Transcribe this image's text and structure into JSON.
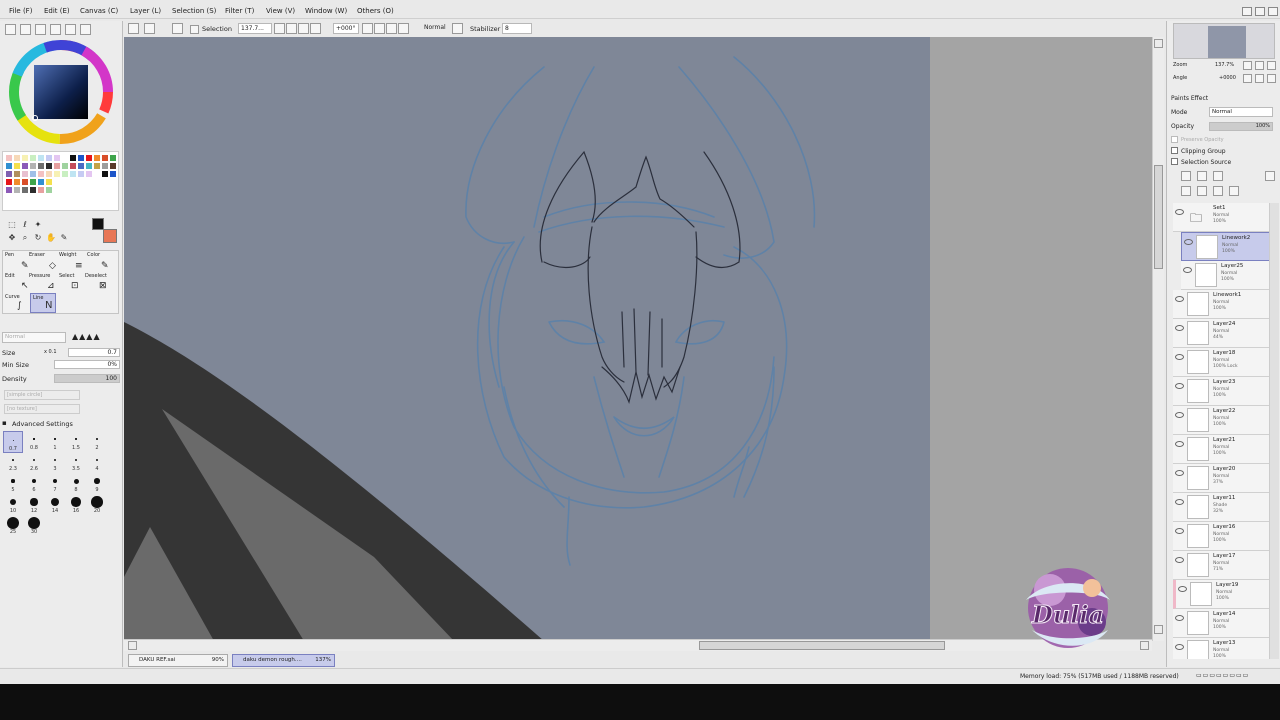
{
  "menu": [
    {
      "label": "File (F)"
    },
    {
      "label": "Edit (E)"
    },
    {
      "label": "Canvas (C)"
    },
    {
      "label": "Layer (L)"
    },
    {
      "label": "Selection (S)"
    },
    {
      "label": "Filter (T)"
    },
    {
      "label": "View (V)"
    },
    {
      "label": "Window (W)"
    },
    {
      "label": "Others (O)"
    }
  ],
  "toolbar": {
    "selection_label": "Selection",
    "zoom_value": "137.7...",
    "angle_value": "+000°",
    "blend_value": "Normal",
    "stabilizer_label": "Stabilizer",
    "stabilizer_value": "8"
  },
  "tools": {
    "brush_tools": [
      {
        "label": "Pen"
      },
      {
        "label": "Eraser"
      },
      {
        "label": "Weight"
      },
      {
        "label": "Color"
      },
      {
        "label": "Edit"
      },
      {
        "label": "Pressure"
      },
      {
        "label": "Select"
      },
      {
        "label": "Deselect"
      },
      {
        "label": "Curve"
      },
      {
        "label": "Line"
      }
    ],
    "mode_value": "Normal",
    "size_label": "Size",
    "size_mult": "x 0.1",
    "size_value": "0.7",
    "minsize_label": "Min Size",
    "minsize_value": "0%",
    "density_label": "Density",
    "density_value": "100",
    "shape_value": "[simple circle]",
    "texture_value": "[no texture]",
    "advanced_label": "Advanced Settings",
    "brush_sizes": [
      "0.7",
      "0.8",
      "1",
      "1.5",
      "2",
      "2.3",
      "2.6",
      "3",
      "3.5",
      "4",
      "5",
      "6",
      "7",
      "8",
      "9",
      "10",
      "12",
      "14",
      "16",
      "20",
      "25",
      "30"
    ]
  },
  "navigator": {
    "zoom_label": "Zoom",
    "zoom_value": "137.7%",
    "angle_label": "Angle",
    "angle_value": "+0000"
  },
  "layer_panel": {
    "paint_effect_label": "Paints Effect",
    "mode_label": "Mode",
    "mode_value": "Normal",
    "opacity_label": "Opacity",
    "opacity_value": "100%",
    "protect_label": "Preserve Opacity",
    "clipping_label": "Clipping Group",
    "selection_source_label": "Selection Source"
  },
  "layers": [
    {
      "name": "Set1",
      "mode": "Normal",
      "opacity": "100%"
    },
    {
      "name": "Linework2",
      "mode": "Normal",
      "opacity": "100%"
    },
    {
      "name": "Layer25",
      "mode": "Normal",
      "opacity": "100%"
    },
    {
      "name": "Linework1",
      "mode": "Normal",
      "opacity": "100%"
    },
    {
      "name": "Layer24",
      "mode": "Normal",
      "opacity": "44%"
    },
    {
      "name": "Layer18",
      "mode": "Normal",
      "opacity": "100% Lock"
    },
    {
      "name": "Layer23",
      "mode": "Normal",
      "opacity": "100%"
    },
    {
      "name": "Layer22",
      "mode": "Normal",
      "opacity": "100%"
    },
    {
      "name": "Layer21",
      "mode": "Normal",
      "opacity": "100%"
    },
    {
      "name": "Layer20",
      "mode": "Normal",
      "opacity": "37%"
    },
    {
      "name": "Layer11",
      "mode": "Shade",
      "opacity": "32%"
    },
    {
      "name": "Layer16",
      "mode": "Normal",
      "opacity": "100%"
    },
    {
      "name": "Layer17",
      "mode": "Normal",
      "opacity": "71%"
    },
    {
      "name": "Layer19",
      "mode": "Normal",
      "opacity": "100%"
    },
    {
      "name": "Layer14",
      "mode": "Normal",
      "opacity": "100%"
    },
    {
      "name": "Layer13",
      "mode": "Normal",
      "opacity": "100%"
    }
  ],
  "doc_tabs": [
    {
      "name": "DAKU REF.sai",
      "zoom": "90%"
    },
    {
      "name": "daku demon rough....",
      "zoom": "137%"
    }
  ],
  "status": {
    "memory": "Memory load: 75% (517MB used / 1188MB reserved)"
  },
  "watermark": {
    "text": "Dulia"
  },
  "colors": {
    "canvas": "#7f8797",
    "sketch": "#5e82a8",
    "accent": "#c7cbeb"
  }
}
